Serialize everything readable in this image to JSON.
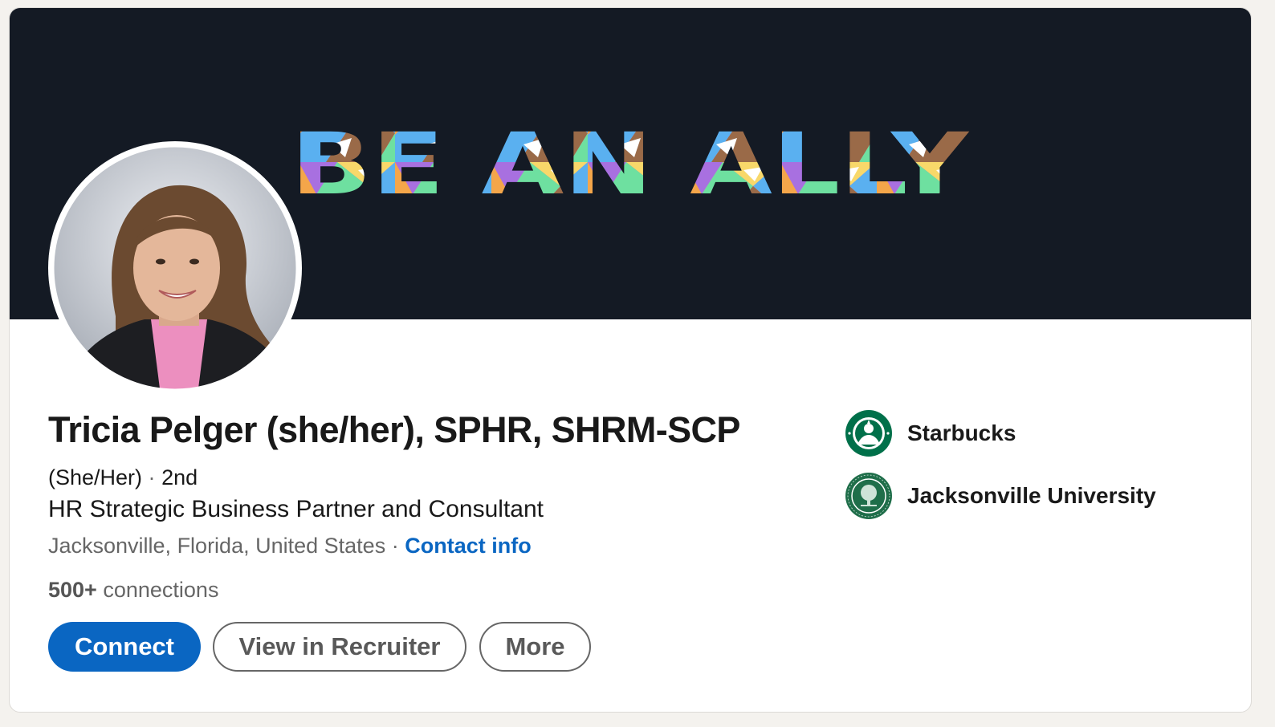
{
  "banner": {
    "text": "BE AN ALLY",
    "background": "#141a24",
    "palette": [
      "#f06ba8",
      "#6ee0a0",
      "#f4a64a",
      "#5ab0f0",
      "#a870e0",
      "#f8d86a",
      "#9a6a48",
      "#ffffff"
    ]
  },
  "profile": {
    "name": "Tricia Pelger (she/her), SPHR, SHRM-SCP",
    "pronouns": "(She/Her)",
    "separator": "·",
    "degree": "2nd",
    "headline": "HR Strategic Business Partner and Consultant",
    "location": "Jacksonville, Florida, United States",
    "contact_info": "Contact info",
    "connections_count": "500+",
    "connections_label": "connections"
  },
  "actions": {
    "connect": "Connect",
    "view_in_recruiter": "View in Recruiter",
    "more": "More"
  },
  "organizations": [
    {
      "name": "Starbucks",
      "icon": "starbucks-logo",
      "color": "#00704a"
    },
    {
      "name": "Jacksonville University",
      "icon": "jacksonville-university-seal",
      "color": "#1f6e4a"
    }
  ],
  "colors": {
    "accent": "#0a66c2",
    "text_primary": "#191919",
    "text_secondary": "#666666"
  }
}
